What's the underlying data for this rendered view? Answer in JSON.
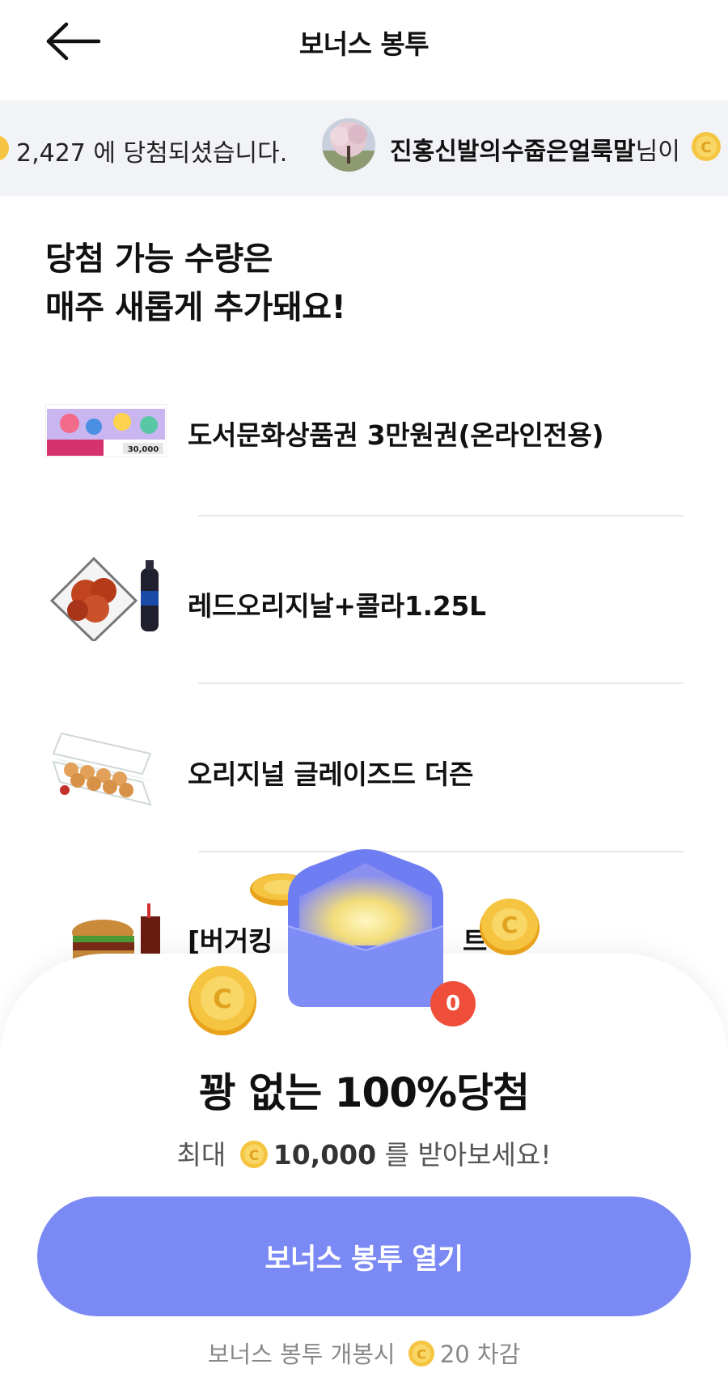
{
  "header": {
    "title": "보너스 봉투"
  },
  "ticker": {
    "text1": "2,427 에 당첨되셨습니다.",
    "name": "진홍신발의수줍은얼룩말",
    "suffix": "님이"
  },
  "heading": {
    "line1": "당첨 가능 수량은",
    "line2": "매주 새롭게 추가돼요!"
  },
  "prizes": [
    {
      "name": "도서문화상품권 3만원권(온라인전용)",
      "image": "book-voucher-image",
      "voucher_amount": "30,000"
    },
    {
      "name": "레드오리지날+콜라1.25L",
      "image": "fried-chicken-cola-image"
    },
    {
      "name": "오리지널 글레이즈드 더즌",
      "image": "donut-box-image"
    },
    {
      "name": "[버거킹",
      "name_tail": "트",
      "image": "burger-set-image"
    }
  ],
  "sheet": {
    "title": "꽝 없는 100%당첨",
    "sub_prefix": "최대",
    "sub_amount": "10,000",
    "sub_suffix": "를 받아보세요!",
    "badge_count": "0",
    "button_label": "보너스 봉투 열기",
    "footnote_prefix": "보너스 봉투 개봉시",
    "footnote_suffix": "20 차감"
  },
  "icons": {
    "back": "arrow-left-icon",
    "coin": "coin-icon",
    "envelope": "envelope-icon"
  },
  "colors": {
    "primary": "#7b89f4",
    "badge": "#ef4f3a",
    "coin": "#f5c542",
    "ticker_bg": "#f2f3f6"
  }
}
